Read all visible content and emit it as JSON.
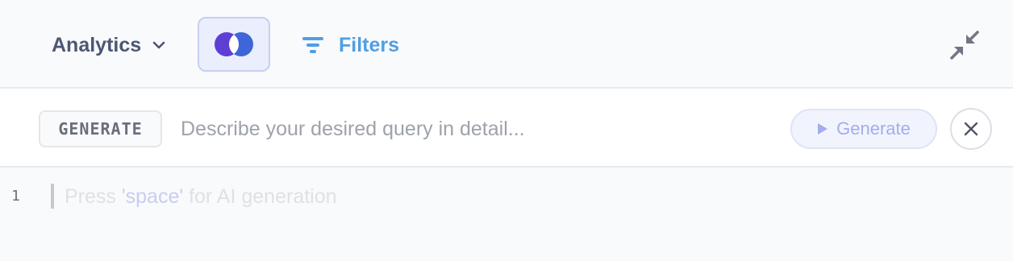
{
  "header": {
    "database": "Analytics",
    "filters_label": "Filters"
  },
  "generate_bar": {
    "badge": "GENERATE",
    "placeholder": "Describe your desired query in detail...",
    "button_label": "Generate"
  },
  "editor": {
    "line_number": "1",
    "hint_before": "Press ",
    "hint_key": "'space'",
    "hint_after": " for AI generation"
  },
  "colors": {
    "accent": "#509ee3",
    "join_blue": "#3f5fd6",
    "join_purple": "#5e3fd4",
    "text_dark": "#4c5773"
  },
  "icons": [
    "chevron-down-icon",
    "join-icon",
    "filter-icon",
    "collapse-icon",
    "play-icon",
    "close-icon"
  ]
}
